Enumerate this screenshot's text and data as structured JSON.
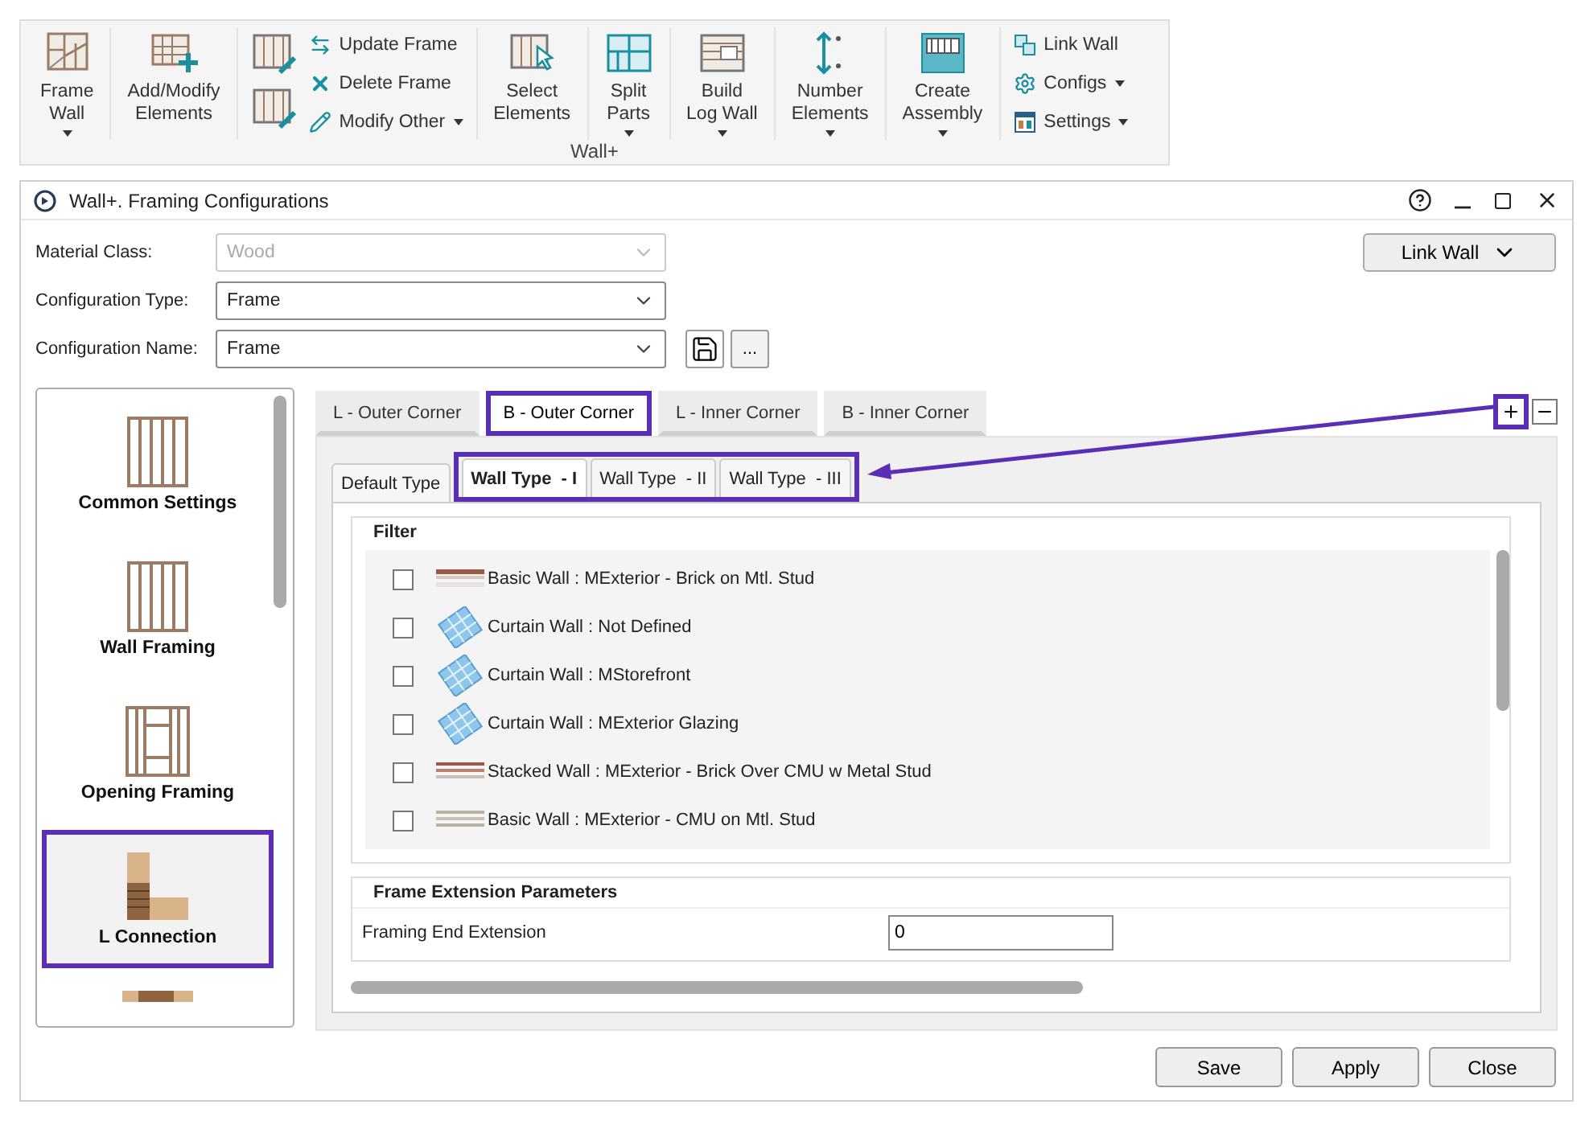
{
  "ribbon": {
    "panel_label": "Wall+",
    "groups": [
      {
        "kind": "large",
        "label": "Frame\nWall",
        "dropdown": true
      },
      {
        "kind": "large",
        "label": "Add/Modify\nElements",
        "dropdown": false
      },
      {
        "kind": "icon_stack",
        "items": [
          {
            "label": "Update Frame",
            "dropdown": false
          },
          {
            "label": "Delete Frame",
            "dropdown": false
          },
          {
            "label": "Modify Other",
            "dropdown": true
          }
        ]
      },
      {
        "kind": "large",
        "label": "Select\nElements",
        "dropdown": false
      },
      {
        "kind": "large",
        "label": "Split\nParts",
        "dropdown": true
      },
      {
        "kind": "large",
        "label": "Build\nLog Wall",
        "dropdown": true
      },
      {
        "kind": "large",
        "label": "Number\nElements",
        "dropdown": true
      },
      {
        "kind": "large",
        "label": "Create\nAssembly",
        "dropdown": true
      },
      {
        "kind": "stack",
        "items": [
          {
            "label": "Link Wall",
            "dropdown": false
          },
          {
            "label": "Configs",
            "dropdown": true
          },
          {
            "label": "Settings",
            "dropdown": true
          }
        ]
      }
    ]
  },
  "dialog": {
    "title": "Wall+. Framing Configurations",
    "fields": [
      {
        "label": "Material Class:",
        "value": "Wood",
        "disabled": true
      },
      {
        "label": "Configuration Type:",
        "value": "Frame",
        "disabled": false
      },
      {
        "label": "Configuration Name:",
        "value": "Frame",
        "disabled": false
      }
    ],
    "more_button": "...",
    "link_button": "Link Wall",
    "sidebar": {
      "items": [
        {
          "kind": "studs",
          "label": "Common Settings",
          "selected": false,
          "highlighted": false
        },
        {
          "kind": "studs",
          "label": "Wall Framing",
          "selected": false,
          "highlighted": false
        },
        {
          "kind": "opening",
          "label": "Opening Framing",
          "selected": false,
          "highlighted": false
        },
        {
          "kind": "l_connection",
          "label": "L Connection",
          "selected": true,
          "highlighted": true
        },
        {
          "kind": "beam",
          "selected": false,
          "highlighted": false
        }
      ]
    },
    "corner_tabs": [
      {
        "label": "L - Outer Corner",
        "selected": false,
        "highlighted": false
      },
      {
        "label": "B - Outer Corner",
        "selected": true,
        "highlighted": true
      },
      {
        "label": "L - Inner Corner",
        "selected": false,
        "highlighted": false
      },
      {
        "label": "B - Inner Corner",
        "selected": false,
        "highlighted": false
      }
    ],
    "add_button": {
      "highlighted": true
    },
    "annotation_arrow": true,
    "wall_type_tabs": [
      {
        "label": "Default Type",
        "selected": false,
        "highlighted": false
      },
      {
        "label": "Wall Type  - I",
        "selected": true,
        "highlighted": true
      },
      {
        "label": "Wall Type  - II",
        "selected": false,
        "highlighted": true
      },
      {
        "label": "Wall Type  - III",
        "selected": false,
        "highlighted": true
      }
    ],
    "filter": {
      "title": "Filter",
      "rows": [
        {
          "kind": "basic",
          "label": "Basic Wall : MExterior - Brick on Mtl. Stud",
          "checked": false
        },
        {
          "kind": "curtain",
          "label": "Curtain Wall : Not Defined",
          "checked": false
        },
        {
          "kind": "curtain",
          "label": "Curtain Wall : MStorefront",
          "checked": false
        },
        {
          "kind": "curtain",
          "label": "Curtain Wall : MExterior Glazing",
          "checked": false
        },
        {
          "kind": "stacked",
          "label": "Stacked Wall : MExterior - Brick Over CMU w Metal Stud",
          "checked": false
        },
        {
          "kind": "cmu",
          "label": "Basic Wall : MExterior - CMU on Mtl. Stud",
          "checked": false
        }
      ]
    },
    "extension": {
      "title": "Frame Extension Parameters",
      "fields": [
        {
          "label": "Framing End Extension",
          "value": "0"
        }
      ]
    },
    "buttons": [
      "Save",
      "Apply",
      "Close"
    ]
  }
}
